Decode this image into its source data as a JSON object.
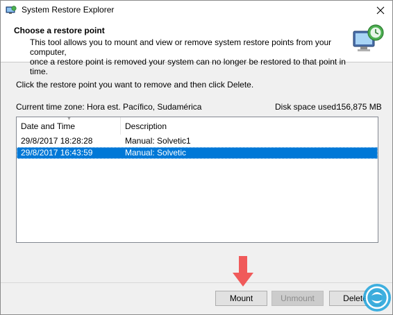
{
  "window": {
    "title": "System Restore Explorer",
    "header_title": "Choose a restore point",
    "header_desc_line1": "This tool allows you to mount and view or remove system restore points from your computer,",
    "header_desc_line2": "once a restore point is removed your system can no longer be restored to that point in time."
  },
  "instruction": "Click the restore point you want to remove and then click Delete.",
  "timezone": "Current time zone: Hora est. Pacífico, Sudamérica",
  "disk_space": {
    "label": "Disk space used:",
    "value": "156,875 MB"
  },
  "list": {
    "columns": [
      "Date and Time",
      "Description"
    ],
    "rows": [
      {
        "date": "29/8/2017 18:28:28",
        "description": "Manual: Solvetic1",
        "selected": false
      },
      {
        "date": "29/8/2017 16:43:59",
        "description": "Manual: Solvetic",
        "selected": true
      }
    ]
  },
  "buttons": {
    "mount": "Mount",
    "unmount": "Unmount",
    "delete": "Delete"
  },
  "colors": {
    "selection": "#0078d7",
    "annotation_arrow": "#f05a5a",
    "watermark": "#1fa3dc"
  },
  "icons": {
    "app": "restore-app-icon",
    "header": "monitor-restore-icon",
    "close": "close-icon",
    "annotation": "red-down-arrow-icon",
    "watermark": "watermark-logo-icon"
  }
}
